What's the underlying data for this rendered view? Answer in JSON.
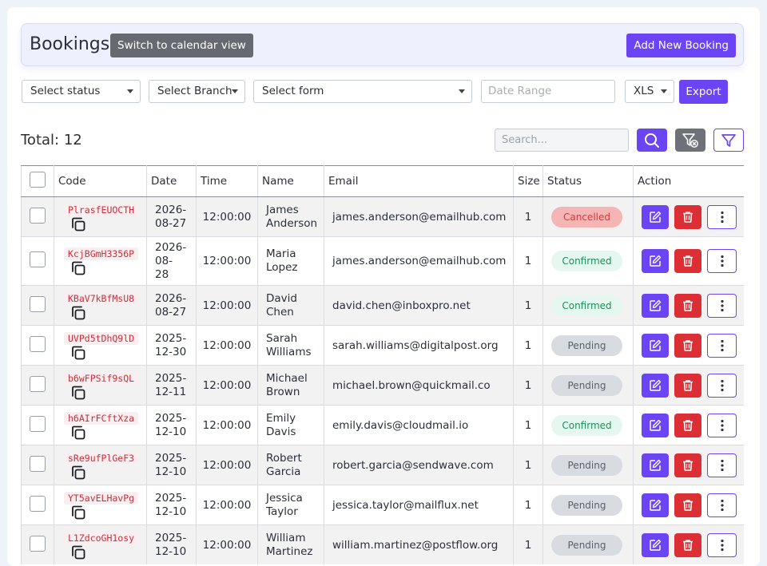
{
  "header": {
    "title": "Bookings",
    "switch_label": "Switch to calendar view",
    "add_label": "Add New Booking"
  },
  "filters": {
    "status": "Select status",
    "branch": "Select Branch",
    "form": "Select form",
    "date_range_placeholder": "Date Range",
    "format": "XLS",
    "export_label": "Export"
  },
  "toolbar": {
    "total": "Total: 12",
    "search_placeholder": "Search..."
  },
  "colors": {
    "accent": "#6b45f5",
    "danger": "#dc2f35",
    "cancelled_bg": "#f5b5b5",
    "cancelled_text": "#d63a3a",
    "confirmed_bg": "#e6f7ef",
    "confirmed_text": "#1f8f5a",
    "pending_bg": "#d8dbe0",
    "pending_text": "#5a5f68"
  },
  "table": {
    "headers": [
      "",
      "Code",
      "Date",
      "Time",
      "Name",
      "Email",
      "Size",
      "Status",
      "Action"
    ],
    "rows": [
      {
        "code": "PlrasfEUOCTH",
        "date": [
          "2026-",
          "08-27"
        ],
        "time": "12:00:00",
        "name": [
          "James",
          "Anderson"
        ],
        "email": "james.anderson@emailhub.com",
        "size": "1",
        "status": "Cancelled"
      },
      {
        "code": "KcjBGmH3356P",
        "date": [
          "2026-",
          "08-",
          "28"
        ],
        "time": "12:00:00",
        "name": [
          "Maria",
          "Lopez"
        ],
        "email": "james.anderson@emailhub.com",
        "size": "1",
        "status": "Confirmed"
      },
      {
        "code": "KBaV7kBfMsU8",
        "date": [
          "2026-",
          "08-27"
        ],
        "time": "12:00:00",
        "name": [
          "David",
          "Chen"
        ],
        "email": "david.chen@inboxpro.net",
        "size": "1",
        "status": "Confirmed"
      },
      {
        "code": "UVPd5tDhQ9lD",
        "date": [
          "2025-",
          "12-30"
        ],
        "time": "12:00:00",
        "name": [
          "Sarah",
          "Williams"
        ],
        "email": "sarah.williams@digitalpost.org",
        "size": "1",
        "status": "Pending"
      },
      {
        "code": "b6wFPSif9sQL",
        "date": [
          "2025-",
          "12-11"
        ],
        "time": "12:00:00",
        "name": [
          "Michael",
          "Brown"
        ],
        "email": "michael.brown@quickmail.co",
        "size": "1",
        "status": "Pending"
      },
      {
        "code": "h6AIrFCftXza",
        "date": [
          "2025-",
          "12-10"
        ],
        "time": "12:00:00",
        "name": [
          "Emily",
          "Davis"
        ],
        "email": "emily.davis@cloudmail.io",
        "size": "1",
        "status": "Confirmed"
      },
      {
        "code": "sRe9ufPlGeF3",
        "date": [
          "2025-",
          "12-10"
        ],
        "time": "12:00:00",
        "name": [
          "Robert",
          "Garcia"
        ],
        "email": "robert.garcia@sendwave.com",
        "size": "1",
        "status": "Pending"
      },
      {
        "code": "YT5avELHavPg",
        "date": [
          "2025-",
          "12-10"
        ],
        "time": "12:00:00",
        "name": [
          "Jessica",
          "Taylor"
        ],
        "email": "jessica.taylor@mailflux.net",
        "size": "1",
        "status": "Pending"
      },
      {
        "code": "L1ZdcoGH1osy",
        "date": [
          "2025-",
          "12-10"
        ],
        "time": "12:00:00",
        "name": [
          "William",
          "Martinez"
        ],
        "email": "william.martinez@postflow.org",
        "size": "1",
        "status": "Pending"
      }
    ]
  }
}
